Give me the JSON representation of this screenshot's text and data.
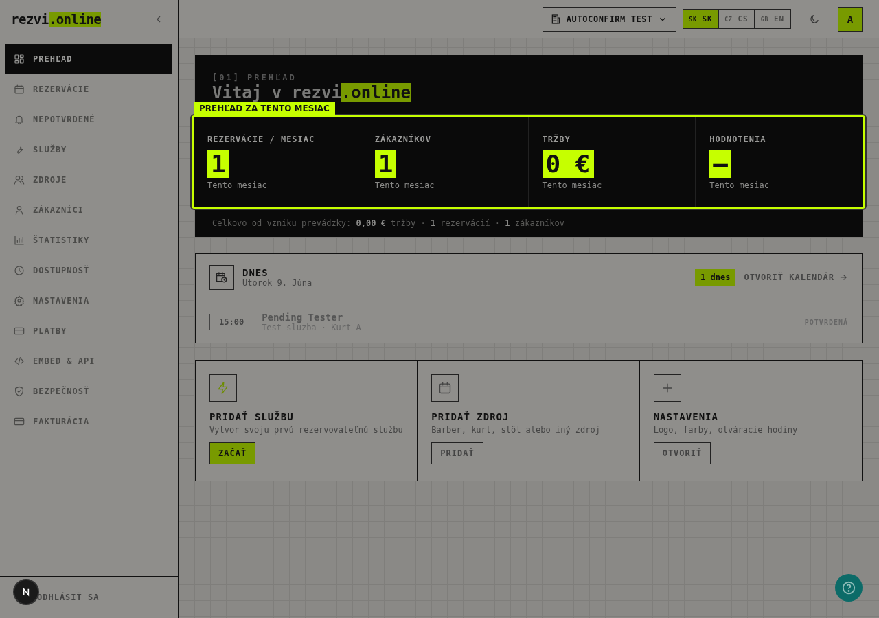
{
  "sidebar": {
    "logo": {
      "text": "rezvi",
      "accent": ".online"
    },
    "items": [
      {
        "label": "PREHĽAD",
        "selected": true
      },
      {
        "label": "REZERVÁCIE",
        "selected": false
      },
      {
        "label": "NEPOTVRDENÉ",
        "selected": false
      },
      {
        "label": "SLUŽBY",
        "selected": false
      },
      {
        "label": "ZDROJE",
        "selected": false
      },
      {
        "label": "ZÁKAZNÍCI",
        "selected": false
      },
      {
        "label": "ŠTATISTIKY",
        "selected": false
      },
      {
        "label": "DOSTUPNOSŤ",
        "selected": false
      },
      {
        "label": "NASTAVENIA",
        "selected": false
      },
      {
        "label": "PLATBY",
        "selected": false
      },
      {
        "label": "EMBED & API",
        "selected": false
      },
      {
        "label": "BEZPEČNOSŤ",
        "selected": false
      },
      {
        "label": "FAKTURÁCIA",
        "selected": false
      }
    ],
    "logout": {
      "label": "ODHLÁSIŤ SA"
    }
  },
  "header": {
    "workspace": "AUTOCONFIRM TEST",
    "languages": [
      {
        "flag": "SK",
        "code": "SK",
        "selected": true
      },
      {
        "flag": "CZ",
        "code": "CS",
        "selected": false
      },
      {
        "flag": "GB",
        "code": "EN",
        "selected": false
      }
    ],
    "avatar": "A"
  },
  "hero": {
    "eyebrow": "[01] PREHĽAD",
    "title": "Vitaj v rezvi",
    "title_accent": ".online",
    "tour_label": "PREHĽAD ZA TENTO MESIAC",
    "stats": [
      {
        "label": "REZERVÁCIE / MESIAC",
        "value": "1",
        "caption": "Tento mesiac"
      },
      {
        "label": "ZÁKAZNÍKOV",
        "value": "1",
        "caption": "Tento mesiac"
      },
      {
        "label": "TRŽBY",
        "value": "0 €",
        "caption": "Tento mesiac"
      },
      {
        "label": "HODNOTENIA",
        "value": "—",
        "caption": "Tento mesiac"
      }
    ],
    "totals": "Celkovo od vzniku prevádzky: **0,00 €** tržby · **1** rezervácií · **1** zákazníkov"
  },
  "today": {
    "title": "DNES",
    "date": "Utorok 9. Júna",
    "badge": "1 dnes",
    "calendar_link": "OTVORIŤ KALENDÁR",
    "bookings": [
      {
        "time": "15:00",
        "name": "Pending Tester",
        "details": "Test sluzba · Kurt A",
        "status": "POTVRDENÁ"
      }
    ]
  },
  "actions": [
    {
      "title": "PRIDAŤ SLUŽBU",
      "description": "Vytvor svoju prvú rezervovateľnú službu",
      "button": "ZAČAŤ",
      "primary": true
    },
    {
      "title": "PRIDAŤ ZDROJ",
      "description": "Barber, kurt, stôl alebo iný zdroj",
      "button": "PRIDAŤ",
      "primary": false
    },
    {
      "title": "NASTAVENIA",
      "description": "Logo, farby, otváracie hodiny",
      "button": "OTVORIŤ",
      "primary": false
    }
  ]
}
